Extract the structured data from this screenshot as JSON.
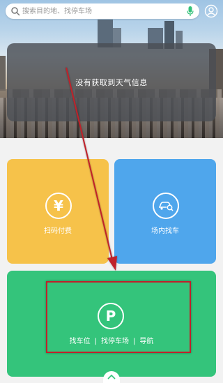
{
  "search": {
    "placeholder": "搜索目的地、找停车场",
    "mic_icon": "mic-icon",
    "user_icon": "user-icon"
  },
  "weather": {
    "message": "没有获取到天气信息"
  },
  "tiles": {
    "pay": {
      "label": "扫码付费",
      "icon": "yen-icon",
      "color": "#f6c24a"
    },
    "find_car": {
      "label": "场内找车",
      "icon": "car-search-icon",
      "color": "#4fa6ec"
    },
    "parking": {
      "icon": "parking-icon",
      "color": "#34c47b",
      "links": [
        "找车位",
        "找停车场",
        "导航"
      ],
      "separator": "|"
    }
  },
  "annotation": {
    "color": "#c0202a"
  },
  "bottom": {
    "icon": "chevron-up-icon"
  }
}
